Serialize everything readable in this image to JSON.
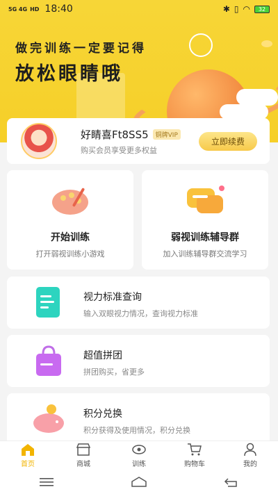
{
  "status_bar": {
    "network": "5G  4G",
    "hd": "HD",
    "time": "18:40",
    "battery": "32"
  },
  "hero": {
    "line1": "做完训练一定要记得",
    "line2": "放松眼睛哦"
  },
  "member": {
    "name": "好睛喜Ft8SS5",
    "badge": "铜牌VIP",
    "subtitle": "购买会员享受更多权益",
    "renew_label": "立即续费"
  },
  "tiles": [
    {
      "title": "开始训练",
      "desc": "打开弱视训练小游戏",
      "icon": "palette-icon"
    },
    {
      "title": "弱视训练辅导群",
      "desc": "加入训练辅导群交流学习",
      "icon": "chat-bubble-icon"
    }
  ],
  "rows": [
    {
      "title": "视力标准查询",
      "desc": "输入双眼视力情况，查询视力标准",
      "icon": "document-icon"
    },
    {
      "title": "超值拼团",
      "desc": "拼团购买，省更多",
      "icon": "shopping-bag-icon"
    },
    {
      "title": "积分兑换",
      "desc": "积分获得及使用情况，积分兑换",
      "icon": "piggy-bank-icon"
    }
  ],
  "tabbar": [
    {
      "label": "首页",
      "icon": "home-icon",
      "active": true
    },
    {
      "label": "商城",
      "icon": "store-icon",
      "active": false
    },
    {
      "label": "训练",
      "icon": "eye-icon",
      "active": false
    },
    {
      "label": "购物车",
      "icon": "cart-icon",
      "active": false
    },
    {
      "label": "我的",
      "icon": "user-icon",
      "active": false
    }
  ],
  "colors": {
    "brand_yellow": "#f6cf28",
    "active_tab": "#f2b400"
  }
}
